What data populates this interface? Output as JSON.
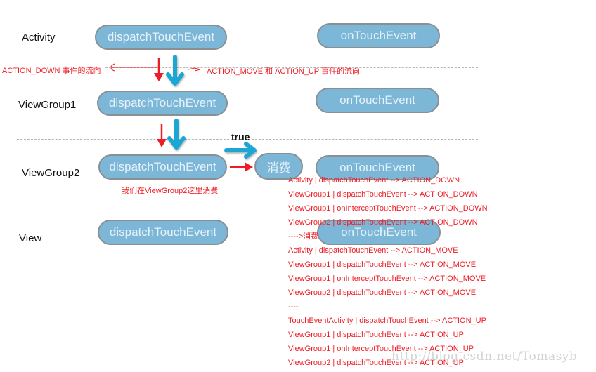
{
  "layers": [
    {
      "label": "Activity",
      "dispatch": "dispatchTouchEvent",
      "ontouch": "onTouchEvent"
    },
    {
      "label": "ViewGroup1",
      "dispatch": "dispatchTouchEvent",
      "ontouch": "onTouchEvent"
    },
    {
      "label": "ViewGroup2",
      "dispatch": "dispatchTouchEvent",
      "ontouch": "onTouchEvent"
    },
    {
      "label": "View",
      "dispatch": "dispatchTouchEvent",
      "ontouch": "onTouchEvent"
    }
  ],
  "legend": {
    "down_flow": "ACTION_DOWN 事件的流向",
    "move_up_flow": "ACTION_MOVE 和 ACTION_UP 事件的流向"
  },
  "consume": {
    "true_label": "true",
    "node_label": "消费",
    "note": "我们在ViewGroup2这里消费"
  },
  "colors": {
    "pill_fill": "#7db7d8",
    "pill_text": "#e6f2fa",
    "red_arrow": "#ee1c25",
    "blue_arrow": "#1ea6d4",
    "log_text": "#ee1c25"
  },
  "log_lines": [
    "Activity | dispatchTouchEvent --> ACTION_DOWN",
    "ViewGroup1 | dispatchTouchEvent --> ACTION_DOWN",
    "ViewGroup1 | onInterceptTouchEvent --> ACTION_DOWN",
    "ViewGroup2 | dispatchTouchEvent --> ACTION_DOWN",
    "---->消费",
    "Activity | dispatchTouchEvent --> ACTION_MOVE",
    "ViewGroup1 | dispatchTouchEvent --> ACTION_MOVE",
    "ViewGroup1 | onInterceptTouchEvent --> ACTION_MOVE",
    "ViewGroup2 | dispatchTouchEvent --> ACTION_MOVE",
    "----",
    "TouchEventActivity | dispatchTouchEvent --> ACTION_UP",
    "ViewGroup1 | dispatchTouchEvent --> ACTION_UP",
    "ViewGroup1 | onInterceptTouchEvent --> ACTION_UP",
    "ViewGroup2 | dispatchTouchEvent --> ACTION_UP"
  ],
  "watermark": "http://blog.csdn.net/Tomasyb"
}
